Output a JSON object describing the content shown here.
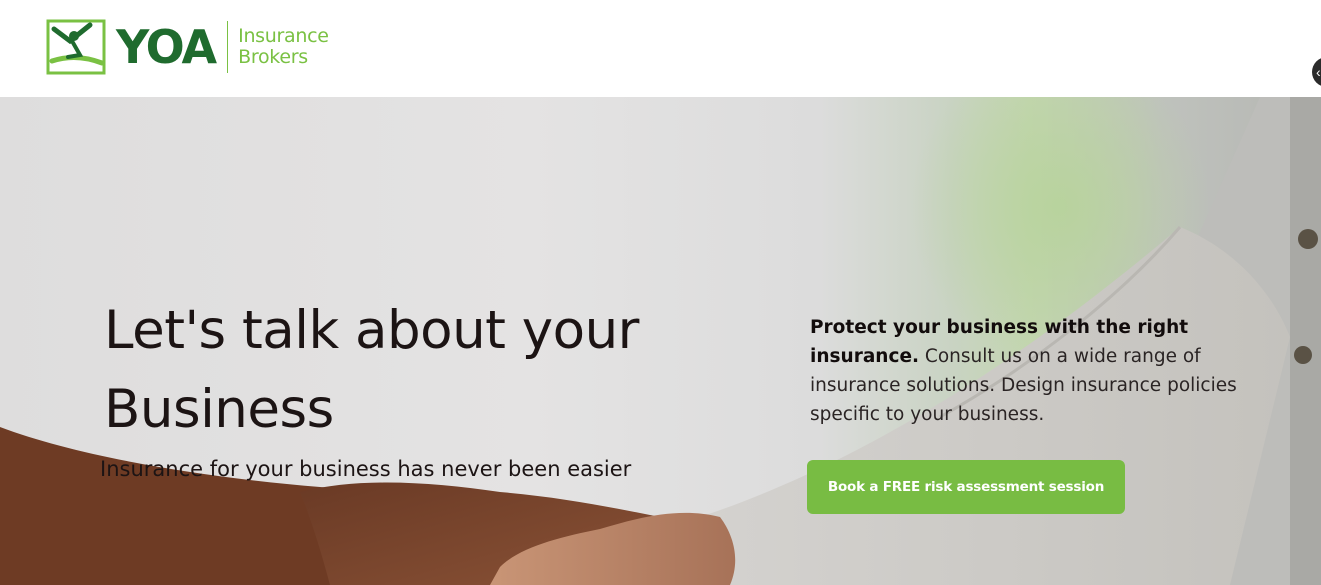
{
  "header": {
    "logo": {
      "brand": "YOA",
      "tagline_line1": "Insurance",
      "tagline_line2": "Brokers",
      "brand_color": "#1f6b2e",
      "accent_color": "#7ac143"
    },
    "corner_button_icon": "chevron-icon"
  },
  "hero": {
    "headline_line1": "Let's talk about your",
    "headline_line2": "Business",
    "subheadline": "Insurance for your business has never been easier",
    "intro_bold": "Protect your business with the right insurance.",
    "intro_rest": "Consult us on a wide range of insurance solutions. Design insurance policies specific to your business.",
    "cta_label": "Book a FREE risk assessment session",
    "cta_color": "#78bc43",
    "background_image": "handshake-photo"
  }
}
